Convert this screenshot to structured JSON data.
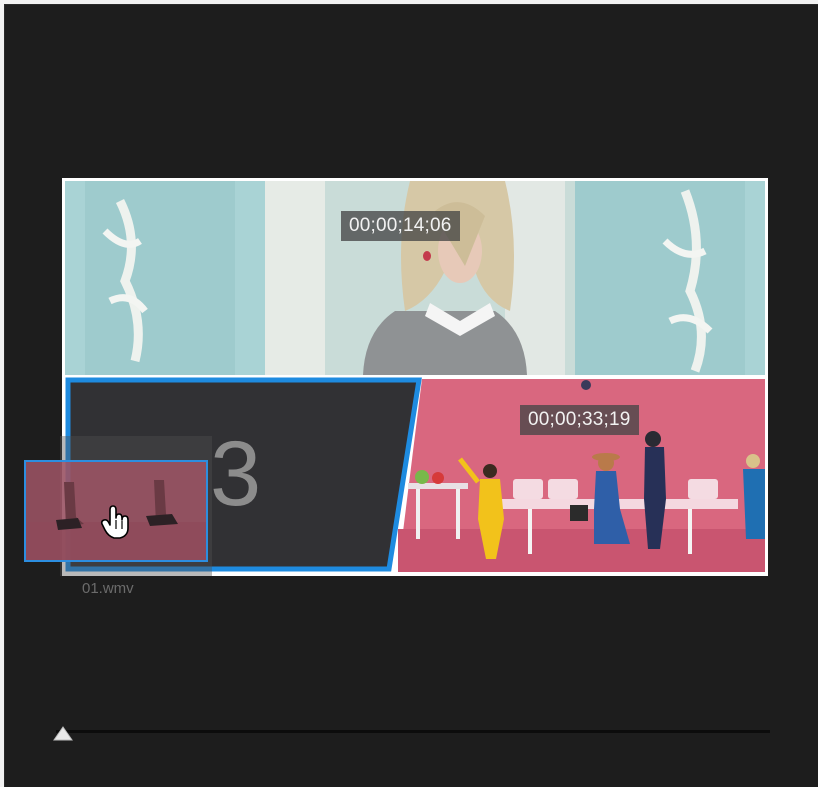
{
  "canvas": {
    "top_cell_timecode": "00;00;14;06",
    "right_cell_timecode": "00;00;33;19",
    "empty_cell_number": "3"
  },
  "drag": {
    "file_name": "01.wmv"
  },
  "slider": {
    "position_fraction": 0.0
  },
  "colors": {
    "panel_bg": "#1d1d1d",
    "selection_blue": "#1e8be0",
    "frame_border": "#ffffff",
    "timecode_bg": "#464646"
  },
  "icons": [
    "hand-cursor-icon",
    "slider-thumb-icon"
  ]
}
